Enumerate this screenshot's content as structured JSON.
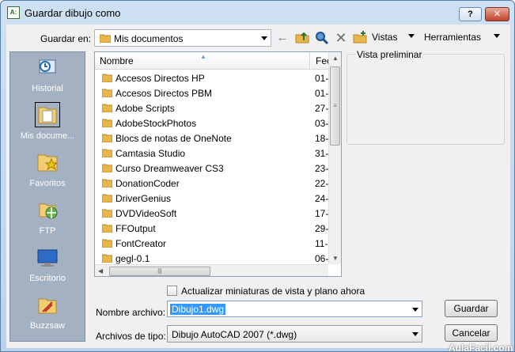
{
  "window": {
    "title": "Guardar dibujo como",
    "app_icon_text": "A:",
    "help_label": "?",
    "close_label": "✕"
  },
  "toolbar": {
    "save_in_label": "Guardar en:",
    "save_in_value": "Mis documentos",
    "views_label": "Vistas",
    "tools_label": "Herramientas"
  },
  "icons": {
    "back": "←",
    "up": "↑",
    "search": "●",
    "delete": "✕",
    "new_folder": "✚"
  },
  "places": [
    {
      "label": "Historial",
      "icon": "history-icon"
    },
    {
      "label": "Mis docume...",
      "icon": "my-documents-icon",
      "selected": true
    },
    {
      "label": "Favoritos",
      "icon": "favorites-icon"
    },
    {
      "label": "FTP",
      "icon": "ftp-icon"
    },
    {
      "label": "Escritorio",
      "icon": "desktop-icon"
    },
    {
      "label": "Buzzsaw",
      "icon": "buzzsaw-icon"
    }
  ],
  "file_list": {
    "col_name": "Nombre",
    "col_date": "Fec",
    "sort_glyph": "▲",
    "rows": [
      {
        "name": "Accesos Directos HP",
        "date": "01-"
      },
      {
        "name": "Accesos Directos PBM",
        "date": "01-"
      },
      {
        "name": "Adobe Scripts",
        "date": "27-"
      },
      {
        "name": "AdobeStockPhotos",
        "date": "03-"
      },
      {
        "name": "Blocs de notas de OneNote",
        "date": "18-"
      },
      {
        "name": "Camtasia Studio",
        "date": "31-"
      },
      {
        "name": "Curso Dreamweaver CS3",
        "date": "23-"
      },
      {
        "name": "DonationCoder",
        "date": "22-"
      },
      {
        "name": "DriverGenius",
        "date": "24-"
      },
      {
        "name": "DVDVideoSoft",
        "date": "17-"
      },
      {
        "name": "FFOutput",
        "date": "29-"
      },
      {
        "name": "FontCreator",
        "date": "11-"
      },
      {
        "name": "gegl-0.1",
        "date": "06-"
      }
    ]
  },
  "preview": {
    "label": "Vista preliminar"
  },
  "options": {
    "update_thumbnails_label": "Actualizar miniaturas de vista y plano ahora"
  },
  "form": {
    "file_name_label": "Nombre archivo:",
    "file_name_value": "Dibujo1.dwg",
    "file_type_label": "Archivos de tipo:",
    "file_type_value": "Dibujo AutoCAD 2007 (*.dwg)"
  },
  "buttons": {
    "save": "Guardar",
    "cancel": "Cancelar"
  },
  "watermark": "AulaFacil.com",
  "colors": {
    "title_bar": "#cfe0f3",
    "places_bar": "#a3b1c3",
    "selection": "#3399ff",
    "folder": "#e8b64a"
  }
}
